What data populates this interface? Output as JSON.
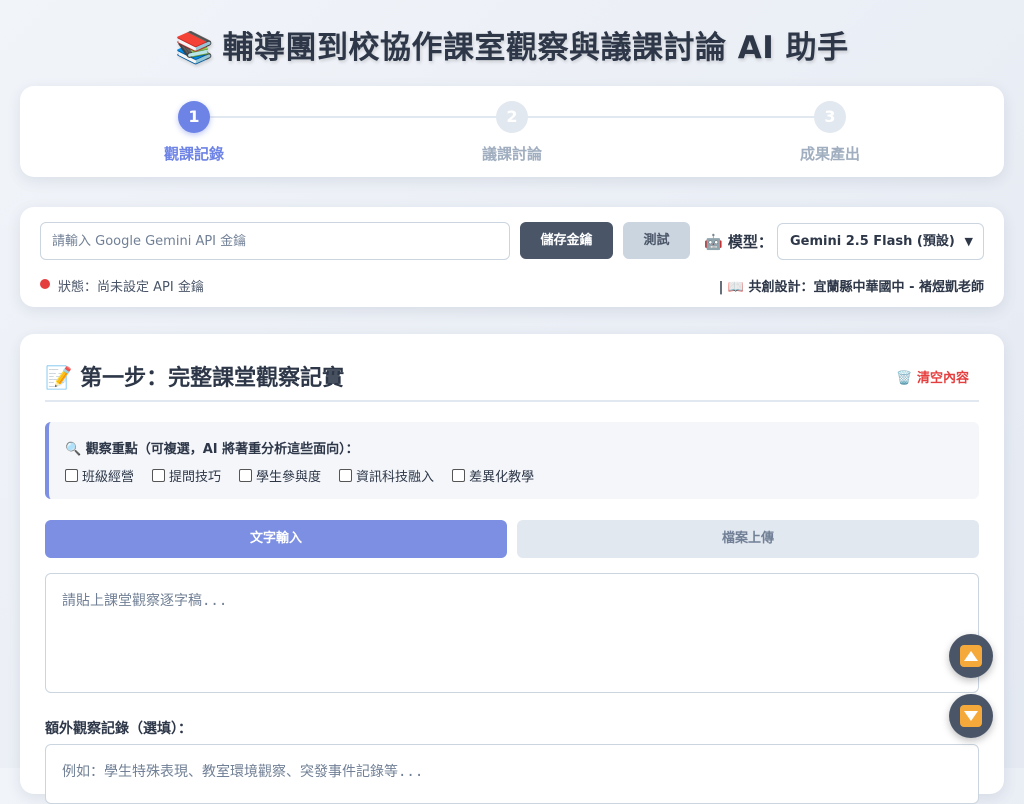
{
  "header": {
    "icon": "books-icon",
    "icon_glyph": "📚",
    "title": "輔導團到校協作課室觀察與議課討論 AI 助手"
  },
  "stepper": {
    "steps": [
      {
        "number": "1",
        "label": "觀課記錄",
        "active": true
      },
      {
        "number": "2",
        "label": "議課討論",
        "active": false
      },
      {
        "number": "3",
        "label": "成果產出",
        "active": false
      }
    ]
  },
  "api": {
    "placeholder": "請輸入 Google Gemini API 金鑰",
    "save_label": "儲存金鑰",
    "test_label": "測試",
    "model_icon": "🤖",
    "model_label": "模型：",
    "model_selected": "Gemini 2.5 Flash (預設)",
    "status_text": "狀態：尚未設定 API 金鑰",
    "status_color": "#e53e3e",
    "credit": "| 📖 共創設計：宜蘭縣中華國中 - 褚煜凱老師"
  },
  "step1": {
    "icon_glyph": "📝",
    "title": "第一步：完整課堂觀察記實",
    "clear_label": "🗑️ 清空內容",
    "focus": {
      "title": "🔍 觀察重點（可複選，AI 將著重分析這些面向）：",
      "options": [
        "班級經營",
        "提問技巧",
        "學生參與度",
        "資訊科技融入",
        "差異化教學"
      ]
    },
    "tabs": {
      "text": "文字輸入",
      "file": "檔案上傳"
    },
    "transcript_placeholder": "請貼上課堂觀察逐字稿...",
    "extra_label": "額外觀察記錄（選填）：",
    "extra_placeholder": "例如：學生特殊表現、教室環境觀察、突發事件記錄等..."
  },
  "colors": {
    "accent": "#6d83e6",
    "tab_active": "#7c8fe3",
    "fab": "#4a5568",
    "fab_icon": "#f6a93b"
  }
}
